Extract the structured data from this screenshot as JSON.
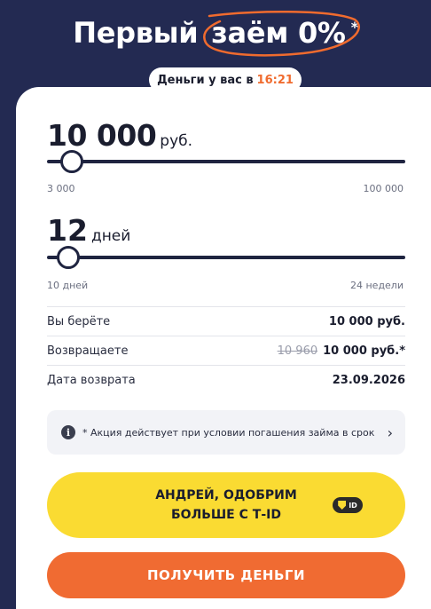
{
  "header": {
    "title_prefix": "Первый",
    "title_highlight": "заём 0%",
    "title_star": "*",
    "time_label": "Деньги у вас в",
    "time_value": "16:21",
    "accent_color": "#f06b2e"
  },
  "loan": {
    "amount": "10 000",
    "amount_unit": "руб.",
    "amount_min": "3 000",
    "amount_max": "100 000",
    "amount_slider_fraction": 0.07,
    "term": "12",
    "term_unit": "дней",
    "term_min": "10 дней",
    "term_max": "24 недели",
    "term_slider_fraction": 0.06
  },
  "summary": {
    "rows": [
      {
        "label": "Вы берёте",
        "value": "10 000 руб."
      },
      {
        "label": "Возвращаете",
        "old_value": "10 960",
        "value": "10 000 руб.*"
      },
      {
        "label": "Дата возврата",
        "value": "23.09.2026"
      }
    ]
  },
  "notice": {
    "icon": "info-icon",
    "text": "* Акция действует при условии погашения займа в срок",
    "chevron": "›"
  },
  "tid_button": {
    "line1": "АНДРЕЙ, ОДОБРИМ",
    "line2": "БОЛЬШЕ С Т-ID",
    "badge_text": "ID",
    "color": "#fadb32"
  },
  "cta": {
    "label": "ПОЛУЧИТЬ ДЕНЬГИ",
    "color": "#f06b32"
  }
}
